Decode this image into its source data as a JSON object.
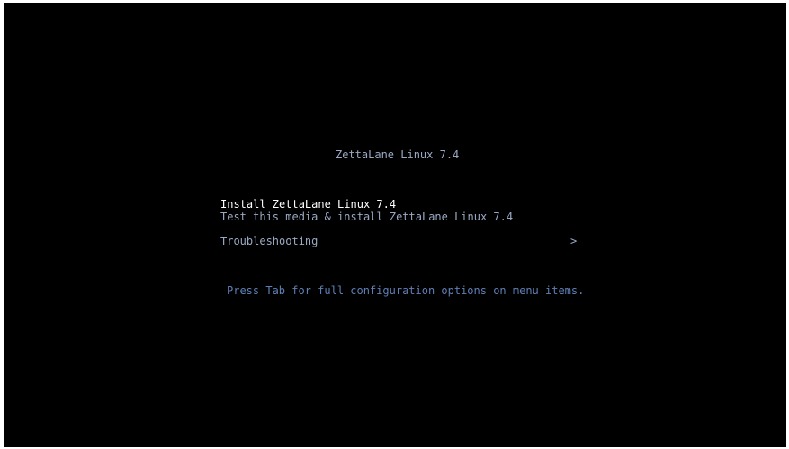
{
  "boot_menu": {
    "title": "ZettaLane Linux 7.4",
    "items": [
      {
        "label": "Install ZettaLane Linux 7.4",
        "selected": true
      },
      {
        "label": "Test this media & install ZettaLane Linux 7.4",
        "selected": false
      },
      {
        "label": "Troubleshooting",
        "selected": false,
        "submenu_indicator": ">"
      }
    ],
    "hint": "Press Tab for full configuration options on menu items."
  },
  "colors": {
    "background": "#000000",
    "text": "#9aa9c3",
    "selected_text": "#ffffff",
    "hint_text": "#5f7fb4"
  }
}
